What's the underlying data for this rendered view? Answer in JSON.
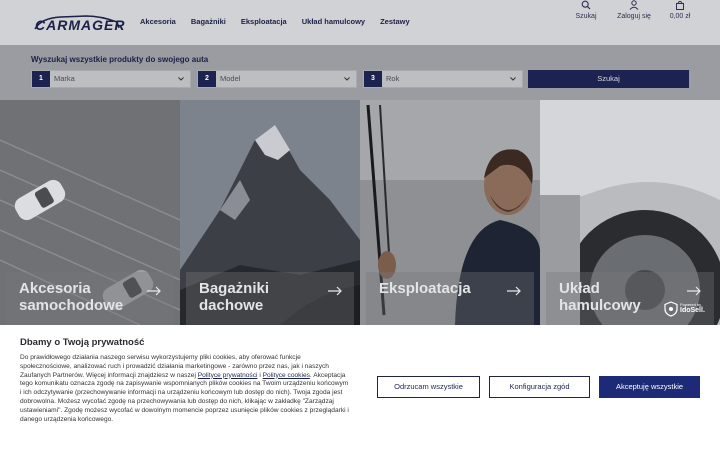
{
  "header": {
    "logo_text": "CARMAGER",
    "nav": [
      "Akcesoria",
      "Bagażniki",
      "Eksploatacja",
      "Układ hamulcowy",
      "Zestawy"
    ],
    "actions": {
      "search": "Szukaj",
      "login": "Zaloguj się",
      "cart": "0,00 zł"
    }
  },
  "search": {
    "title": "Wyszukaj wszystkie produkty do swojego auta",
    "selects": [
      {
        "num": "1",
        "value": "Marka"
      },
      {
        "num": "2",
        "value": "Model"
      },
      {
        "num": "3",
        "value": "Rok"
      }
    ],
    "button": "Szukaj"
  },
  "tiles": [
    {
      "line1": "Akcesoria",
      "line2": "samochodowe"
    },
    {
      "line1": "Bagażniki",
      "line2": "dachowe"
    },
    {
      "line1": "Eksploatacja",
      "line2": ""
    },
    {
      "line1": "Układ",
      "line2": "hamulcowy"
    }
  ],
  "badge": {
    "small": "Powered by",
    "big": "IdoSell."
  },
  "cookie": {
    "title": "Dbamy o Twoją prywatność",
    "text_1": "Do prawidłowego działania naszego serwisu wykorzystujemy pliki cookies, aby oferować funkcje społecznościowe, analizować ruch i prowadzić działania marketingowe - zarówno przez nas, jak i naszych Zaufanych Partnerów. Więcej informacji znajdziesz w naszej ",
    "link_1": "Polityce prywatności",
    "text_2": " i ",
    "link_2": "Polityce cookies",
    "text_3": ". Akceptacja tego komunikatu oznacza zgodę na zapisywanie wspomnianych plików cookies na Twoim urządzeniu końcowym i ich odczytywanie (przechowywanie informacji na urządzeniu końcowym lub dostęp do nich). Twoja zgoda jest dobrowolna. Możesz wycofać zgodę na przechowywania lub dostęp do nich, klikając w zakładkę \"Zarządzaj ustawieniami\". Zgodę możesz wycofać w dowolnym momencie poprzez usunięcie plików cookies z przeglądarki i danego urządzenia końcowego.",
    "buttons": {
      "reject": "Odrzucam wszystkie",
      "config": "Konfiguracja zgód",
      "accept": "Akceptuję wszystkie"
    }
  }
}
